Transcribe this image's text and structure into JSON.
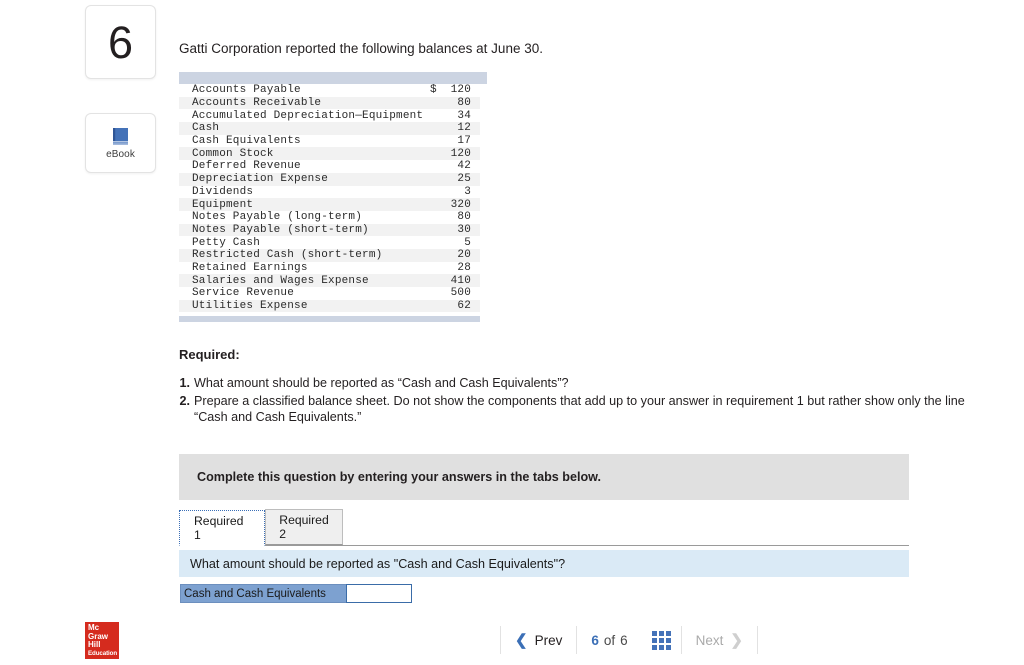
{
  "question_number": "6",
  "sidebar": {
    "ebook_label": "eBook",
    "ebook_icon": "book-icon"
  },
  "intro_text": "Gatti Corporation reported the following balances at June 30.",
  "balances_table": {
    "currency_symbol": "$",
    "rows": [
      {
        "label": "Accounts Payable",
        "symbol": "$",
        "value": "120"
      },
      {
        "label": "Accounts Receivable",
        "symbol": "",
        "value": "80"
      },
      {
        "label": "Accumulated Depreciation—Equipment",
        "symbol": "",
        "value": "34"
      },
      {
        "label": "Cash",
        "symbol": "",
        "value": "12"
      },
      {
        "label": "Cash Equivalents",
        "symbol": "",
        "value": "17"
      },
      {
        "label": "Common Stock",
        "symbol": "",
        "value": "120"
      },
      {
        "label": "Deferred Revenue",
        "symbol": "",
        "value": "42"
      },
      {
        "label": "Depreciation Expense",
        "symbol": "",
        "value": "25"
      },
      {
        "label": "Dividends",
        "symbol": "",
        "value": "3"
      },
      {
        "label": "Equipment",
        "symbol": "",
        "value": "320"
      },
      {
        "label": "Notes Payable (long-term)",
        "symbol": "",
        "value": "80"
      },
      {
        "label": "Notes Payable (short-term)",
        "symbol": "",
        "value": "30"
      },
      {
        "label": "Petty Cash",
        "symbol": "",
        "value": "5"
      },
      {
        "label": "Restricted Cash (short-term)",
        "symbol": "",
        "value": "20"
      },
      {
        "label": "Retained Earnings",
        "symbol": "",
        "value": "28"
      },
      {
        "label": "Salaries and Wages Expense",
        "symbol": "",
        "value": "410"
      },
      {
        "label": "Service Revenue",
        "symbol": "",
        "value": "500"
      },
      {
        "label": "Utilities Expense",
        "symbol": "",
        "value": "62"
      }
    ]
  },
  "required": {
    "heading": "Required:",
    "items": [
      {
        "num": "1.",
        "text": "What amount should be reported as “Cash and Cash Equivalents”?"
      },
      {
        "num": "2.",
        "text": "Prepare a classified balance sheet. Do not show the components that add up to your answer in requirement 1 but rather show only the line “Cash and Cash Equivalents.”"
      }
    ]
  },
  "answer_panel": {
    "instruction": "Complete this question by entering your answers in the tabs below.",
    "tabs": [
      {
        "label": "Required 1",
        "active": true
      },
      {
        "label": "Required 2",
        "active": false
      }
    ],
    "question_banner": "What amount should be reported as \"Cash and Cash Equivalents\"?",
    "answer_row": {
      "label": "Cash and Cash Equivalents",
      "value": "",
      "placeholder": ""
    }
  },
  "footer": {
    "logo": {
      "line1": "Mc",
      "line2": "Graw",
      "line3": "Hill",
      "line4": "Education"
    },
    "prev_label": "Prev",
    "current_page": "6",
    "of_label": "of",
    "total_pages": "6",
    "grid_icon": "grid-icon",
    "next_label": "Next"
  },
  "colors": {
    "accent_blue": "#3b6fb6",
    "table_header": "#ccd4e2",
    "panel_gray": "#e0e0e0",
    "banner_blue": "#daeaf6",
    "answer_label_blue": "#7da1d0",
    "logo_red": "#d52b1e"
  }
}
